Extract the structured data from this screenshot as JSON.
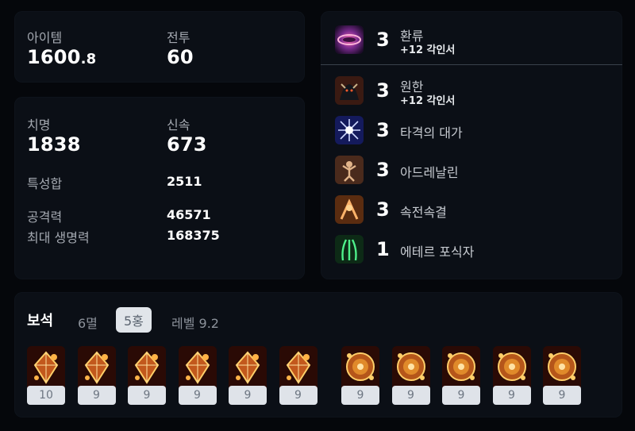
{
  "stats_top": {
    "item_label": "아이템",
    "item_value_main": "1600",
    "item_value_dec": ".8",
    "combat_label": "전투",
    "combat_value": "60"
  },
  "stats": {
    "crit_label": "치명",
    "crit_value": "1838",
    "swift_label": "신속",
    "swift_value": "673",
    "total_label": "특성합",
    "total_value": "2511",
    "atk_label": "공격력",
    "atk_value": "46571",
    "hp_label": "최대 생명력",
    "hp_value": "168375"
  },
  "engravings": [
    {
      "level": "3",
      "name": "환류",
      "sub": "+12 각인서",
      "icon": "vortex-icon"
    },
    {
      "level": "3",
      "name": "원한",
      "sub": "+12 각인서",
      "icon": "grudge-icon"
    },
    {
      "level": "3",
      "name": "타격의 대가",
      "sub": "",
      "icon": "hit-master-icon"
    },
    {
      "level": "3",
      "name": "아드레날린",
      "sub": "",
      "icon": "adrenaline-icon"
    },
    {
      "level": "3",
      "name": "속전속결",
      "sub": "",
      "icon": "swift-strike-icon"
    },
    {
      "level": "1",
      "name": "에테르 포식자",
      "sub": "",
      "icon": "ether-predator-icon"
    }
  ],
  "gems": {
    "title": "보석",
    "filters": [
      "6멸",
      "5홍",
      "레벨 9.2"
    ],
    "active_filter_index": 1,
    "left_group": [
      "10",
      "9",
      "9",
      "9",
      "9",
      "9"
    ],
    "right_group": [
      "9",
      "9",
      "9",
      "9",
      "9"
    ]
  },
  "colors": {
    "background": "#05070b",
    "card": "#0b0f16",
    "label": "#a4a9b1",
    "chip_active": "#e1e5ea"
  }
}
